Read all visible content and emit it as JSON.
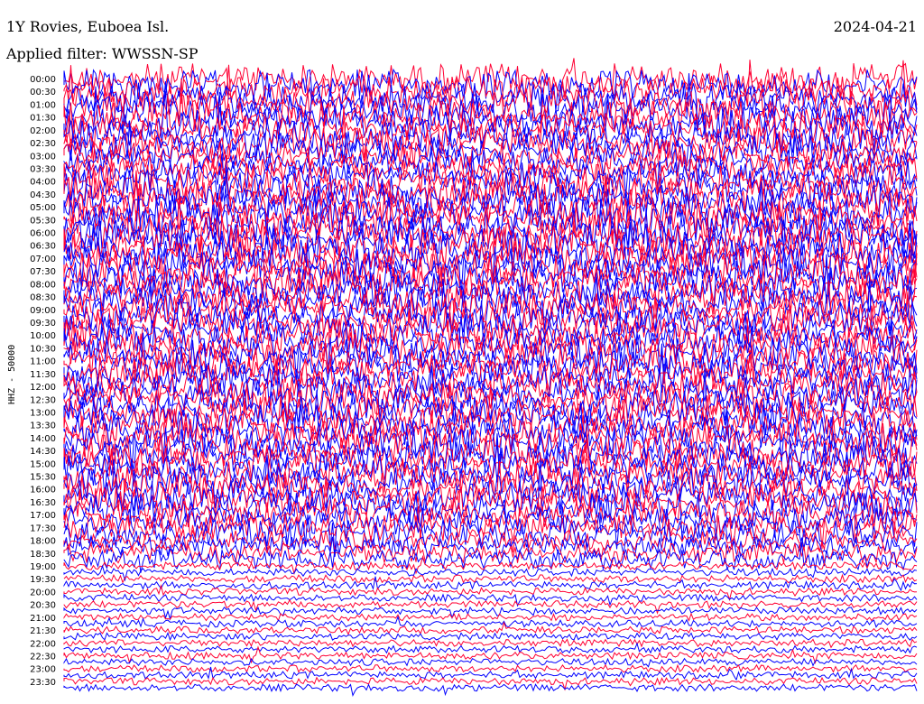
{
  "header": {
    "station": "1Y Rovies, Euboea Isl.",
    "date": "2024-04-21",
    "filter": "Applied filter: WWSSN-SP"
  },
  "channel_label": "HHZ - 50000",
  "colors": {
    "trace_a": "#0000ff",
    "trace_b": "#ff0033",
    "background": "#ffffff"
  },
  "chart_data": {
    "type": "line",
    "title": "1Y Rovies, Euboea Isl.",
    "subtitle": "Applied filter: WWSSN-SP",
    "ylabel": "HHZ - 50000",
    "xlabel": "",
    "helicorder": true,
    "row_minutes": 15,
    "y_tick_labels": [
      "00:00",
      "00:30",
      "01:00",
      "01:30",
      "02:00",
      "02:30",
      "03:00",
      "03:30",
      "04:00",
      "04:30",
      "05:00",
      "05:30",
      "06:00",
      "06:30",
      "07:00",
      "07:30",
      "08:00",
      "08:30",
      "09:00",
      "09:30",
      "10:00",
      "10:30",
      "11:00",
      "11:30",
      "12:00",
      "12:30",
      "13:00",
      "13:30",
      "14:00",
      "14:30",
      "15:00",
      "15:30",
      "16:00",
      "16:30",
      "17:00",
      "17:30",
      "18:00",
      "18:30",
      "19:00",
      "19:30",
      "20:00",
      "20:30",
      "21:00",
      "21:30",
      "22:00",
      "22:30",
      "23:00",
      "23:30"
    ],
    "series": [
      {
        "color": "#0000ff",
        "rows": "odd quarter-hours"
      },
      {
        "color": "#ff0033",
        "rows": "even quarter-hours"
      }
    ],
    "relative_amplitude_by_hour": [
      2.4,
      2.6,
      2.6,
      2.2,
      2.8,
      3.0,
      3.0,
      2.8,
      2.8,
      2.6,
      2.6,
      2.6,
      2.6,
      2.6,
      2.6,
      2.6,
      2.4,
      2.2,
      1.6,
      0.6,
      0.55,
      0.55,
      0.55,
      0.55
    ],
    "grid": false,
    "legend": "none"
  }
}
